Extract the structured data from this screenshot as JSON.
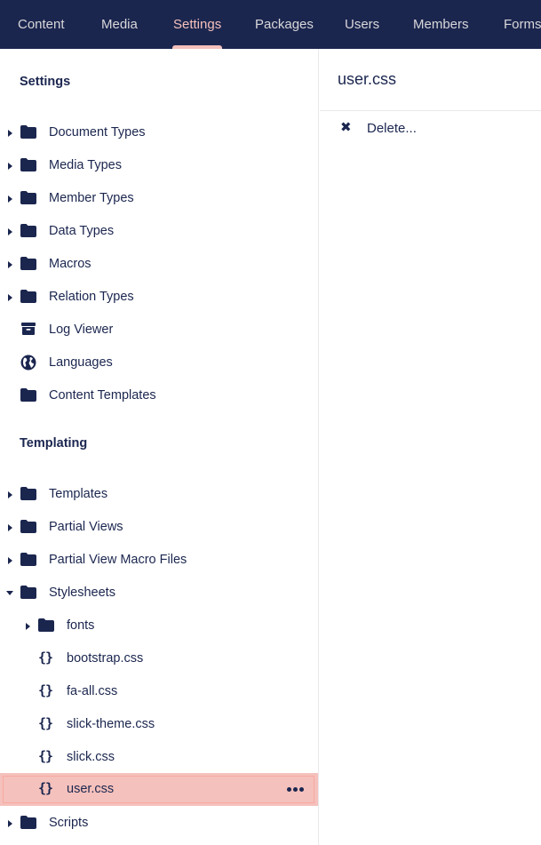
{
  "colors": {
    "nav_background": "#1b264f",
    "nav_text": "#d8d7d9",
    "nav_active": "#f5c1bc",
    "text_primary": "#1b264f",
    "selected_background": "#f5c1bc"
  },
  "topnav": {
    "tabs": [
      {
        "label": "Content",
        "active": false
      },
      {
        "label": "Media",
        "active": false
      },
      {
        "label": "Settings",
        "active": true
      },
      {
        "label": "Packages",
        "active": false
      },
      {
        "label": "Users",
        "active": false
      },
      {
        "label": "Members",
        "active": false
      },
      {
        "label": "Forms",
        "active": false
      }
    ]
  },
  "tree": {
    "settings_title": "Settings",
    "settings_items": [
      {
        "label": "Document Types",
        "icon": "folder-icon",
        "expandable": true
      },
      {
        "label": "Media Types",
        "icon": "folder-icon",
        "expandable": true
      },
      {
        "label": "Member Types",
        "icon": "folder-icon",
        "expandable": true
      },
      {
        "label": "Data Types",
        "icon": "folder-icon",
        "expandable": true
      },
      {
        "label": "Macros",
        "icon": "folder-icon",
        "expandable": true
      },
      {
        "label": "Relation Types",
        "icon": "folder-icon",
        "expandable": true
      },
      {
        "label": "Log Viewer",
        "icon": "archive-box-icon",
        "expandable": false
      },
      {
        "label": "Languages",
        "icon": "globe-icon",
        "expandable": false
      },
      {
        "label": "Content Templates",
        "icon": "folder-icon",
        "expandable": false
      }
    ],
    "templating_title": "Templating",
    "templating_items": [
      {
        "label": "Templates",
        "icon": "folder-icon",
        "expandable": true
      },
      {
        "label": "Partial Views",
        "icon": "folder-icon",
        "expandable": true
      },
      {
        "label": "Partial View Macro Files",
        "icon": "folder-icon",
        "expandable": true
      },
      {
        "label": "Stylesheets",
        "icon": "folder-icon",
        "expandable": true,
        "expanded": true
      }
    ],
    "stylesheet_children": [
      {
        "label": "fonts",
        "icon": "folder-icon",
        "expandable": true
      },
      {
        "label": "bootstrap.css",
        "icon": "css-braces-icon",
        "expandable": false
      },
      {
        "label": "fa-all.css",
        "icon": "css-braces-icon",
        "expandable": false
      },
      {
        "label": "slick-theme.css",
        "icon": "css-braces-icon",
        "expandable": false
      },
      {
        "label": "slick.css",
        "icon": "css-braces-icon",
        "expandable": false
      },
      {
        "label": "user.css",
        "icon": "css-braces-icon",
        "expandable": false,
        "selected": true
      }
    ],
    "scripts_item": {
      "label": "Scripts",
      "icon": "folder-icon",
      "expandable": true
    },
    "brace_glyph": "{}"
  },
  "editor": {
    "file_title": "user.css",
    "actions": [
      {
        "label": "Delete...",
        "icon": "close-icon",
        "glyph": "✖"
      }
    ]
  }
}
